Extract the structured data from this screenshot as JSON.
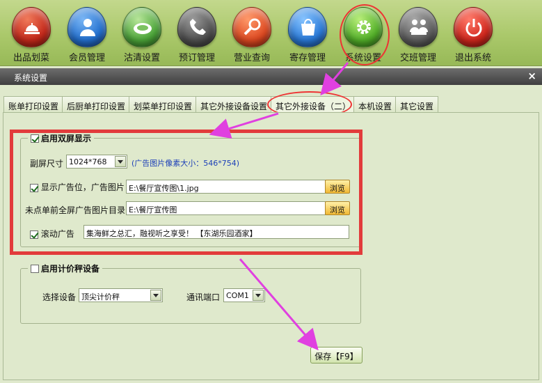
{
  "toolbar": {
    "items": [
      {
        "label": "出品划菜",
        "icon": "cloche-icon"
      },
      {
        "label": "会员管理",
        "icon": "member-icon"
      },
      {
        "label": "沽清设置",
        "icon": "plate-icon"
      },
      {
        "label": "预订管理",
        "icon": "phone-icon"
      },
      {
        "label": "营业查询",
        "icon": "search-icon"
      },
      {
        "label": "寄存管理",
        "icon": "bag-icon"
      },
      {
        "label": "系统设置",
        "icon": "gear-icon"
      },
      {
        "label": "交班管理",
        "icon": "handover-icon"
      },
      {
        "label": "退出系统",
        "icon": "power-icon"
      }
    ]
  },
  "window": {
    "title": "系统设置",
    "close": "×"
  },
  "tabs": [
    "账单打印设置",
    "后厨单打印设置",
    "划菜单打印设置",
    "其它外接设备设置",
    "其它外接设备（二）",
    "本机设置",
    "其它设置"
  ],
  "active_tab": "其它外接设备（二）",
  "dual_screen": {
    "title": "启用双屏显示",
    "enabled": true,
    "screen_size_label": "副屏尺寸",
    "screen_size_value": "1024*768",
    "ad_size_note": "(广告图片像素大小：546*754)",
    "show_ad_label": "显示广告位，广告图片",
    "show_ad_checked": true,
    "ad_image_path": "E:\\餐厅宣传图\\1.jpg",
    "browse_label": "浏览",
    "fullscreen_dir_label": "未点单前全屏广告图片目录",
    "fullscreen_dir_path": "E:\\餐厅宣传图",
    "scroll_ad_label": "滚动广告",
    "scroll_ad_checked": true,
    "scroll_ad_text": "集海鲜之总汇，融视听之享受！ 【东湖乐园酒家】"
  },
  "scale": {
    "title": "启用计价秤设备",
    "enabled": false,
    "device_label": "选择设备",
    "device_value": "顶尖计价秤",
    "port_label": "通讯端口",
    "port_value": "COM1"
  },
  "save_label": "保存【F9】",
  "colors": {
    "annotation_red": "#e23b3b",
    "arrow_magenta": "#e040e0"
  }
}
